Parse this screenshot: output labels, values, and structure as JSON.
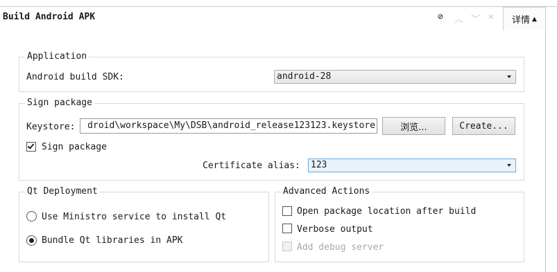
{
  "header": {
    "title": "Build Android APK",
    "icons": [
      "block-icon",
      "chevron-up-icon",
      "chevron-down-icon",
      "close-icon"
    ],
    "details_label": "详情"
  },
  "application": {
    "group_title": "Application",
    "sdk_label": "Android build SDK:",
    "sdk_value": "android-28"
  },
  "sign_package": {
    "group_title": "Sign package",
    "keystore_label": "Keystore:",
    "keystore_value": "droid\\workspace\\My\\DSB\\android_release123123.keystore",
    "browse_label": "浏览...",
    "create_label": "Create...",
    "sign_checkbox_label": "Sign package",
    "sign_checked": true,
    "alias_label": "Certificate alias:",
    "alias_value": "123"
  },
  "qt_deployment": {
    "group_title": "Qt Deployment",
    "options": [
      {
        "label": "Use Ministro service to install Qt",
        "selected": false
      },
      {
        "label": "Bundle Qt libraries in APK",
        "selected": true
      }
    ]
  },
  "advanced_actions": {
    "group_title": "Advanced Actions",
    "options": [
      {
        "label": "Open package location after build",
        "checked": false,
        "enabled": true
      },
      {
        "label": "Verbose output",
        "checked": false,
        "enabled": true
      },
      {
        "label": "Add debug server",
        "checked": false,
        "enabled": false
      }
    ]
  }
}
